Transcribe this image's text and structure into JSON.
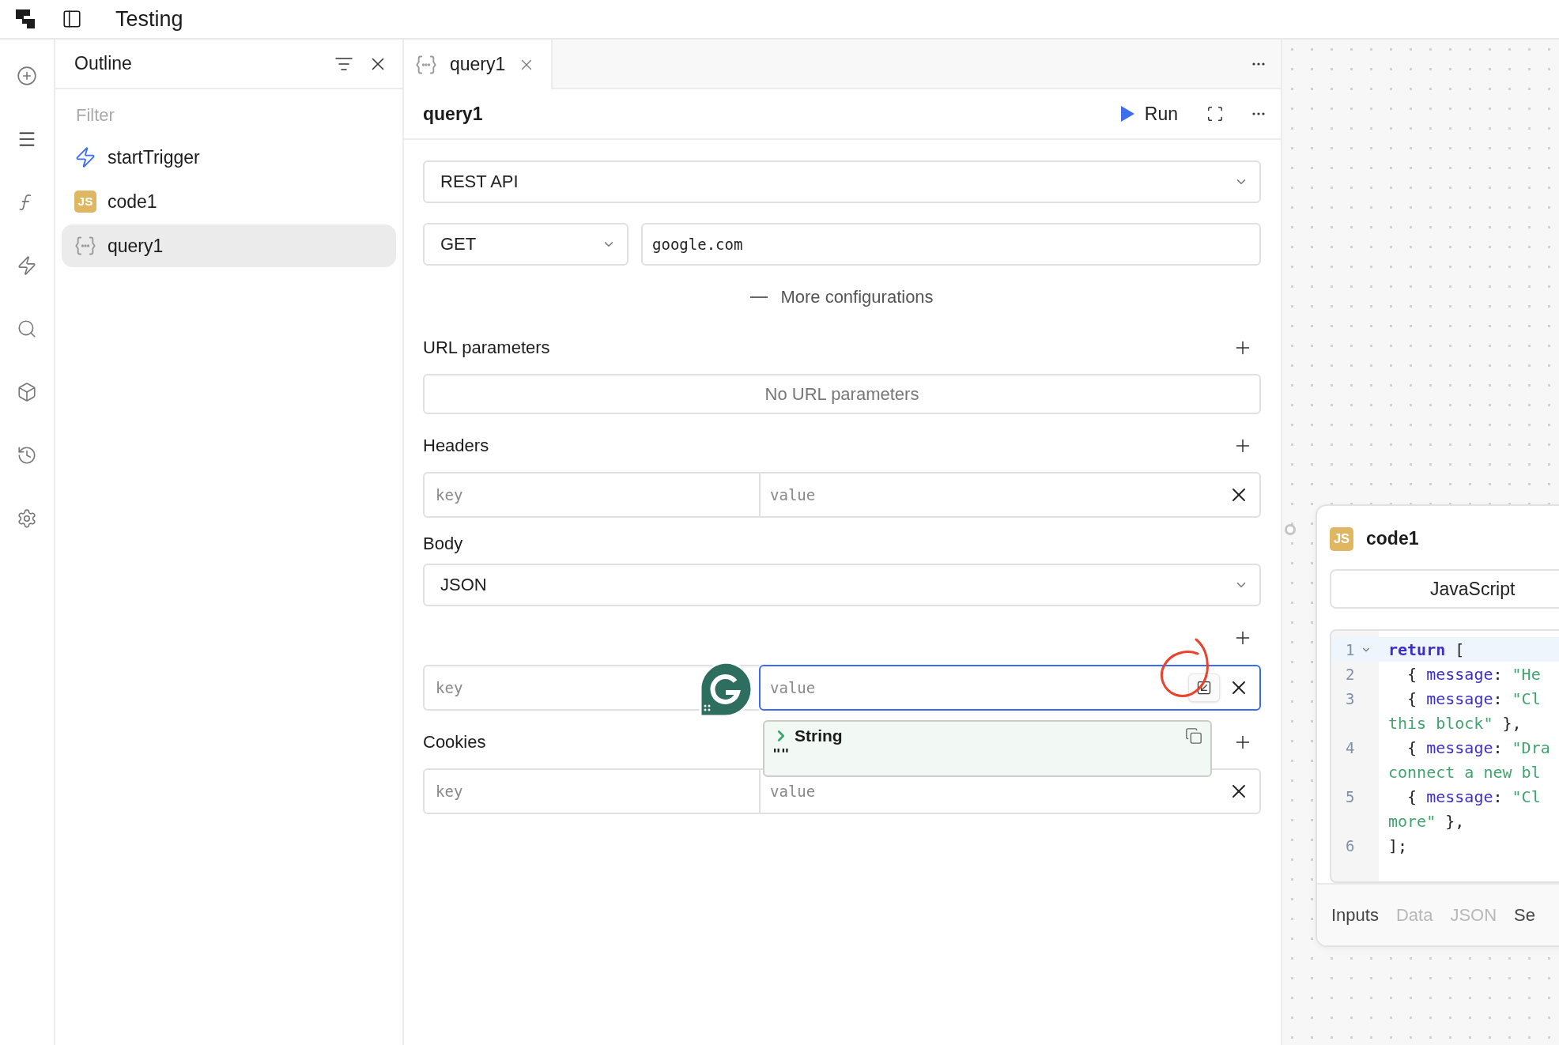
{
  "app": {
    "title": "Testing"
  },
  "rail": [
    {
      "selected": false
    },
    {
      "selected": true
    },
    {
      "selected": false
    },
    {
      "selected": false
    },
    {
      "selected": false
    },
    {
      "selected": false
    },
    {
      "selected": false
    },
    {
      "selected": false
    }
  ],
  "outline": {
    "title": "Outline",
    "filter_placeholder": "Filter",
    "items": [
      {
        "kind": "trigger",
        "label": "startTrigger",
        "selected": false
      },
      {
        "kind": "code",
        "badge": "JS",
        "label": "code1",
        "selected": false
      },
      {
        "kind": "query",
        "label": "query1",
        "selected": true
      }
    ]
  },
  "editor": {
    "tabs": [
      {
        "label": "query1",
        "selected": true
      }
    ],
    "title": "query1",
    "run_label": "Run",
    "resource": "REST API",
    "method": "GET",
    "url": "google.com",
    "more_label": "More configurations",
    "url_params": {
      "label": "URL parameters",
      "empty": "No URL parameters"
    },
    "headers": {
      "label": "Headers",
      "rows": [
        {
          "key_placeholder": "key",
          "value_placeholder": "value",
          "focused": false
        }
      ]
    },
    "body": {
      "label": "Body",
      "type": "JSON",
      "rows": [
        {
          "key_placeholder": "key",
          "value_placeholder": "value",
          "focused": true
        }
      ]
    },
    "cookies": {
      "label": "Cookies",
      "rows": [
        {
          "key_placeholder": "key",
          "value_placeholder": "value",
          "focused": false
        }
      ]
    },
    "value_popup": {
      "type": "String",
      "value": "\"\""
    }
  },
  "canvas": {
    "card": {
      "badge": "JS",
      "title": "code1",
      "language": "JavaScript",
      "lines": [
        {
          "number": "1",
          "active": true,
          "tokens": [
            {
              "kind": "keyword",
              "text": "return"
            },
            {
              "kind": "punct",
              "text": " ["
            }
          ]
        },
        {
          "number": "2",
          "active": false,
          "tokens": [
            {
              "kind": "punct",
              "text": "  { "
            },
            {
              "kind": "prop",
              "text": "message"
            },
            {
              "kind": "punct",
              "text": ": "
            },
            {
              "kind": "string",
              "text": "\"He"
            }
          ]
        },
        {
          "number": "3",
          "active": false,
          "tokens": [
            {
              "kind": "punct",
              "text": "  { "
            },
            {
              "kind": "prop",
              "text": "message"
            },
            {
              "kind": "punct",
              "text": ": "
            },
            {
              "kind": "string",
              "text": "\"Cl"
            }
          ]
        },
        {
          "active": false,
          "tokens": [
            {
              "kind": "string",
              "text": "this block\""
            },
            {
              "kind": "punct",
              "text": " },"
            }
          ]
        },
        {
          "number": "4",
          "active": false,
          "tokens": [
            {
              "kind": "punct",
              "text": "  { "
            },
            {
              "kind": "prop",
              "text": "message"
            },
            {
              "kind": "punct",
              "text": ": "
            },
            {
              "kind": "string",
              "text": "\"Dra"
            }
          ]
        },
        {
          "active": false,
          "tokens": [
            {
              "kind": "string",
              "text": "connect a new bl"
            }
          ]
        },
        {
          "number": "5",
          "active": false,
          "tokens": [
            {
              "kind": "punct",
              "text": "  { "
            },
            {
              "kind": "prop",
              "text": "message"
            },
            {
              "kind": "punct",
              "text": ": "
            },
            {
              "kind": "string",
              "text": "\"Cl"
            }
          ]
        },
        {
          "active": false,
          "tokens": [
            {
              "kind": "string",
              "text": "more\""
            },
            {
              "kind": "punct",
              "text": " },"
            }
          ]
        },
        {
          "number": "6",
          "active": false,
          "tokens": [
            {
              "kind": "punct",
              "text": "];"
            }
          ]
        }
      ],
      "tabs": [
        {
          "label": "Inputs",
          "disabled": false
        },
        {
          "label": "Data",
          "disabled": true
        },
        {
          "label": "JSON",
          "disabled": true
        },
        {
          "label": "Se",
          "disabled": false
        }
      ]
    }
  }
}
